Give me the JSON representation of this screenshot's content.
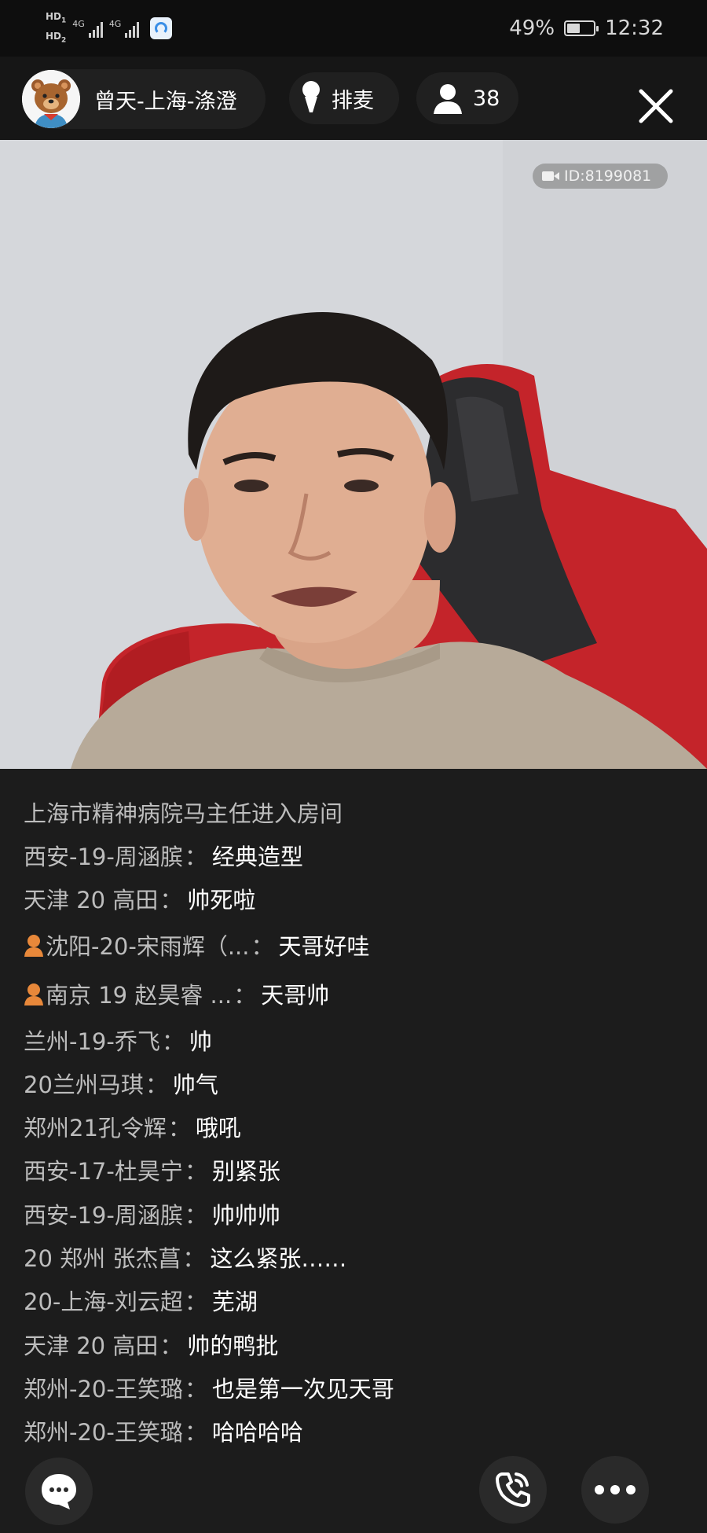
{
  "status_bar": {
    "hd1": "HD",
    "hd1_index": "1",
    "hd2": "HD",
    "hd2_index": "2",
    "network1": "4G",
    "network2": "4G",
    "battery_percent": "49%",
    "battery_level": 0.49,
    "time": "12:32"
  },
  "header": {
    "host_name": "曾天-上海-涤澄",
    "queue_label": "排麦",
    "viewer_count": "38"
  },
  "video": {
    "room_id": "ID:8199081"
  },
  "chat": {
    "system_message": "上海市精神病院马主任进入房间",
    "messages": [
      {
        "user": "西安-19-周涵膑",
        "text": "经典造型"
      },
      {
        "user": "天津 20  高田",
        "text": "帅死啦"
      },
      {
        "user": "沈阳-20-宋雨辉（...",
        "text": "天哥好哇"
      },
      {
        "user": "南京 19 赵昊睿 ...",
        "text": "天哥帅"
      },
      {
        "user": "兰州-19-乔飞",
        "text": "帅"
      },
      {
        "user": "20兰州马琪",
        "text": "帅气"
      },
      {
        "user": "郑州21孔令辉",
        "text": "哦吼"
      },
      {
        "user": "西安-17-杜昊宁",
        "text": "别紧张"
      },
      {
        "user": "西安-19-周涵膑",
        "text": "帅帅帅"
      },
      {
        "user": "20 郑州 张杰菖",
        "text": "这么紧张……"
      },
      {
        "user": "20-上海-刘云超",
        "text": "芜湖"
      },
      {
        "user": "天津 20  高田",
        "text": "帅的鸭批"
      },
      {
        "user": "郑州-20-王笑璐",
        "text": "也是第一次见天哥"
      },
      {
        "user": "郑州-20-王笑璐",
        "text": "哈哈哈哈"
      }
    ],
    "separator": "："
  },
  "icons": {
    "chat": "chat-bubble-icon",
    "call": "phone-call-icon",
    "more": "more-dots-icon",
    "close": "close-icon",
    "mic": "microphone-icon",
    "person": "person-icon",
    "vip": "vip-user-icon"
  },
  "colors": {
    "background": "#1c1c1c",
    "status_bar": "#0e0e0e",
    "header": "#161616",
    "chat_user": "#bdbdbd",
    "chat_text": "#ffffff",
    "vip_icon": "#e8883a"
  }
}
